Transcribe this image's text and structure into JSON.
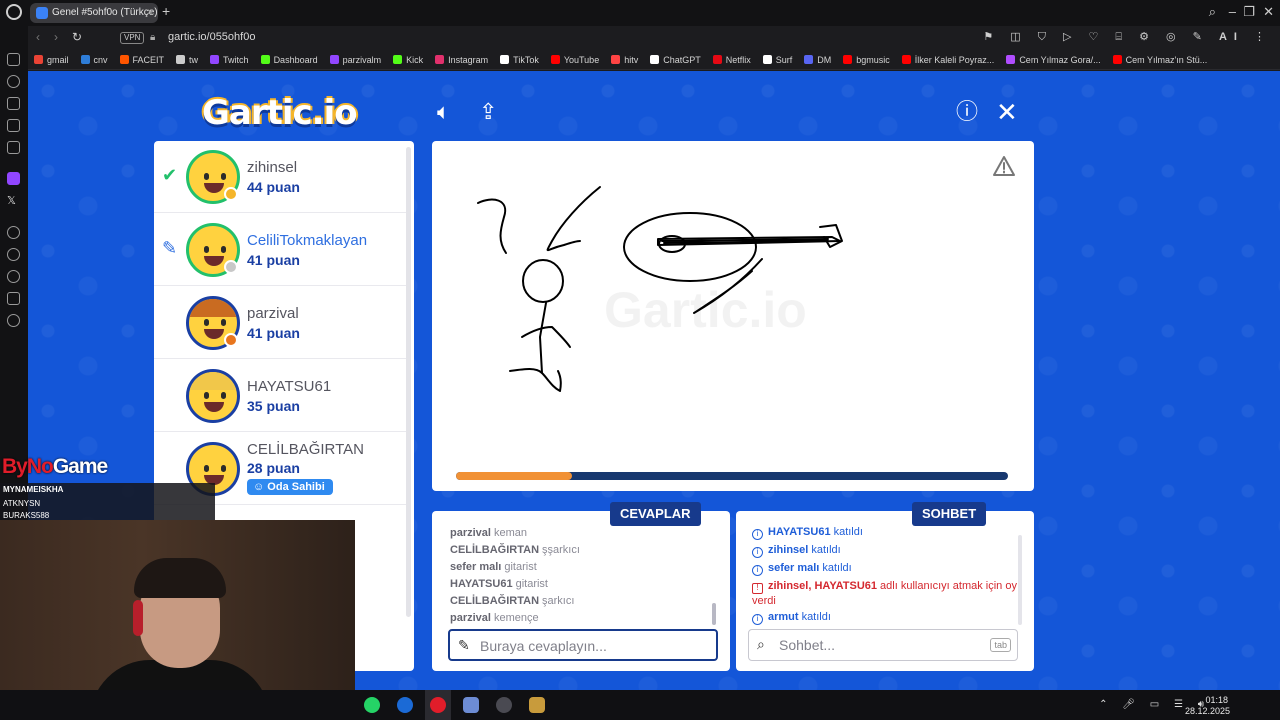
{
  "browser": {
    "tab_title": "Genel #5ohf0o (Türkçe)",
    "tab_close": "×",
    "new_tab": "+",
    "vpn_label": "VPN",
    "url": "gartic.io/055ohf0o",
    "bookmarks": [
      "gmail",
      "cnv",
      "FACEIT",
      "tw",
      "Twitch",
      "Dashboard",
      "parzivalm",
      "Kick",
      "Instagram",
      "TikTok",
      "YouTube",
      "hitv",
      "ChatGPT",
      "Netflix",
      "Surf",
      "DM",
      "bgmusic",
      "İlker Kaleli Poyraz...",
      "Cem Yılmaz Gora/...",
      "Cem Yılmaz'ın Stü..."
    ],
    "addr_ai": "AI"
  },
  "game": {
    "logo": "Gartic.io",
    "players": [
      {
        "name": "zihinsel",
        "score": "44 puan",
        "mark": "check",
        "dot_color": "#f5b52a"
      },
      {
        "name": "CeliliTokmaklayan",
        "score": "41 puan",
        "mark": "pencil",
        "dot_color": "#c8c8c8",
        "highlight": true
      },
      {
        "name": "parzival",
        "score": "41 puan",
        "mark": "",
        "dot_color": "#e8761e"
      },
      {
        "name": "HAYATSU61",
        "score": "35 puan",
        "mark": "",
        "dot_color": ""
      },
      {
        "name": "CELİLBAĞIRTAN",
        "score": "28 puan",
        "mark": "",
        "dot_color": "",
        "badge": "Oda Sahibi"
      }
    ],
    "canvas_watermark": "Gartic.io",
    "timer_progress": 0.21,
    "answers_tab": "CEVAPLAR",
    "chat_tab": "SOHBET",
    "answers": [
      {
        "user": "parzival",
        "text": "keman"
      },
      {
        "user": "CELİLBAĞIRTAN",
        "text": "şşarkıcı"
      },
      {
        "user": "sefer malı",
        "text": "gitarist"
      },
      {
        "user": "HAYATSU61",
        "text": "gitarist"
      },
      {
        "user": "CELİLBAĞIRTAN",
        "text": "şarkıcı"
      },
      {
        "user": "parzival",
        "text": "kemençe"
      }
    ],
    "chat": [
      {
        "user": "HAYATSU61",
        "text": "katıldı",
        "type": "info"
      },
      {
        "user": "zihinsel",
        "text": "katıldı",
        "type": "info"
      },
      {
        "user": "sefer malı",
        "text": "katıldı",
        "type": "info"
      },
      {
        "user": "zihinsel, HAYATSU61",
        "text": "adlı kullanıcıyı atmak için oy verdi",
        "type": "alert"
      },
      {
        "user": "armut",
        "text": "katıldı",
        "type": "info"
      }
    ],
    "answer_placeholder": "Buraya cevaplayın...",
    "chat_placeholder": "Sohbet...",
    "chat_tab_key": "tab"
  },
  "overlay": {
    "brand_a": "ByNo",
    "brand_b": "Game",
    "follow_list": [
      "MYNAMEISKHA",
      "ATKNYSN",
      "BURAKS588"
    ]
  },
  "taskbar": {
    "time": "01:18",
    "date": "28.12.2025"
  }
}
